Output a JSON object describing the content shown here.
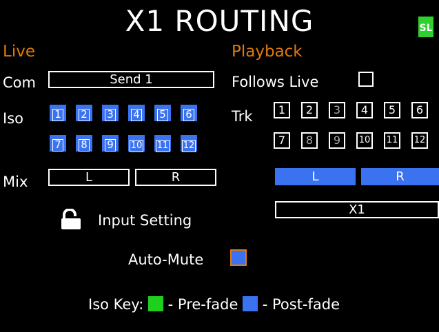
{
  "header": {
    "title": "X1 ROUTING",
    "badge": "SL"
  },
  "live": {
    "heading": "Live",
    "com_label": "Com",
    "com_value": "Send 1",
    "iso_label": "Iso",
    "iso_cells": [
      "1",
      "2",
      "3",
      "4",
      "5",
      "6",
      "7",
      "8",
      "9",
      "10",
      "11",
      "12"
    ],
    "mix_label": "Mix",
    "mix_left": "L",
    "mix_right": "R",
    "input_setting": "Input Setting",
    "auto_mute": "Auto-Mute"
  },
  "playback": {
    "heading": "Playback",
    "follows_live": "Follows Live",
    "trk_label": "Trk",
    "trk_cells": [
      "1",
      "2",
      "3",
      "4",
      "5",
      "6",
      "7",
      "8",
      "9",
      "10",
      "11",
      "12"
    ],
    "mix_left": "L",
    "mix_right": "R",
    "source": "X1"
  },
  "legend": {
    "iso_key": "Iso Key:",
    "pre_fade": "- Pre-fade",
    "post_fade": "- Post-fade",
    "pre_color": "#1ecf1e",
    "post_color": "#3b72f0"
  },
  "colors": {
    "accent": "#e07a0c",
    "selected": "#3b72f0",
    "badge": "#2fd12f"
  }
}
